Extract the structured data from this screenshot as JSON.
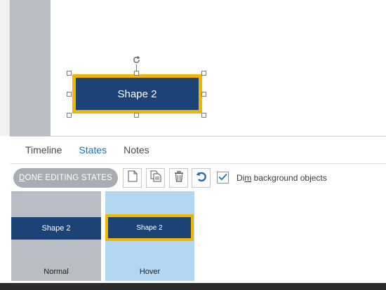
{
  "canvas": {
    "shape_label": "Shape 2"
  },
  "tabs": [
    {
      "label": "Timeline"
    },
    {
      "label": "States"
    },
    {
      "label": "Notes"
    }
  ],
  "toolbar": {
    "done_label": "DONE EDITING STATES",
    "new_state_icon": "new-page-icon",
    "duplicate_icon": "duplicate-icon",
    "delete_icon": "trash-icon",
    "reset_icon": "undo-icon",
    "dim_checked": true,
    "dim_label": "Dim background objects"
  },
  "states": [
    {
      "name": "Normal",
      "shape_label": "Shape 2"
    },
    {
      "name": "Hover",
      "shape_label": "Shape 2"
    }
  ],
  "colors": {
    "shape_fill": "#1c4376",
    "shape_border": "#f1b400",
    "active_tab": "#1a73b8",
    "hover_thumb_bg": "#b3d6f1"
  }
}
